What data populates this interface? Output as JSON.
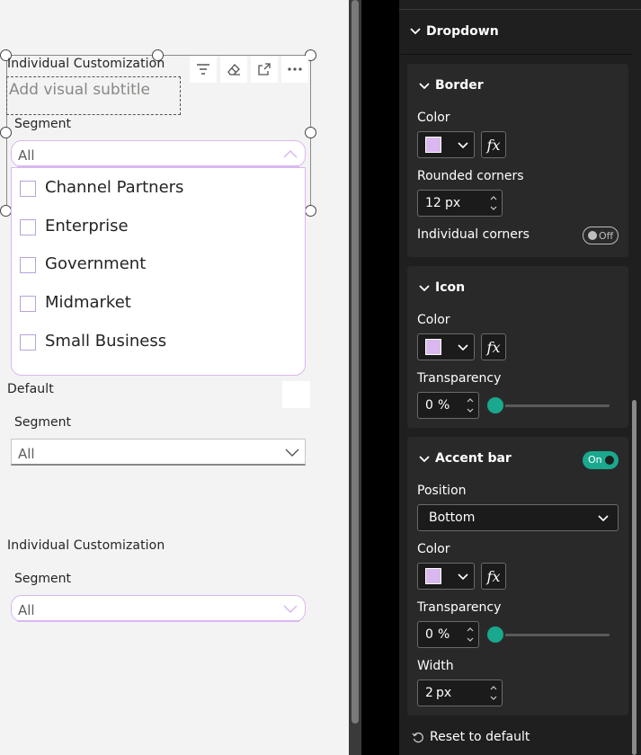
{
  "canvas": {
    "visual1": {
      "title": "Individual Customization",
      "subtitle_placeholder": "Add visual subtitle",
      "segment_label": "Segment",
      "selected_value": "All",
      "items": [
        "Channel Partners",
        "Enterprise",
        "Government",
        "Midmarket",
        "Small Business"
      ]
    },
    "visual2": {
      "title": "Default",
      "segment_label": "Segment",
      "selected_value": "All"
    },
    "visual3": {
      "title": "Individual Customization",
      "segment_label": "Segment",
      "selected_value": "All"
    }
  },
  "pane": {
    "dropdown_title": "Dropdown",
    "border": {
      "title": "Border",
      "color_label": "Color",
      "color": "#d9b8ef",
      "rounded_label": "Rounded corners",
      "rounded_value": "12",
      "rounded_unit": "px",
      "individual_label": "Individual corners",
      "individual_toggle": "Off"
    },
    "icon": {
      "title": "Icon",
      "color_label": "Color",
      "color": "#d9b8ef",
      "transparency_label": "Transparency",
      "transparency_value": "0",
      "transparency_unit": "%"
    },
    "accent": {
      "title": "Accent bar",
      "toggle": "On",
      "position_label": "Position",
      "position_value": "Bottom",
      "color_label": "Color",
      "color": "#d9b8ef",
      "transparency_label": "Transparency",
      "transparency_value": "0",
      "transparency_unit": "%",
      "width_label": "Width",
      "width_value": "2",
      "width_unit": "px"
    },
    "reset_label": "Reset to default",
    "fx_label": "fx"
  }
}
